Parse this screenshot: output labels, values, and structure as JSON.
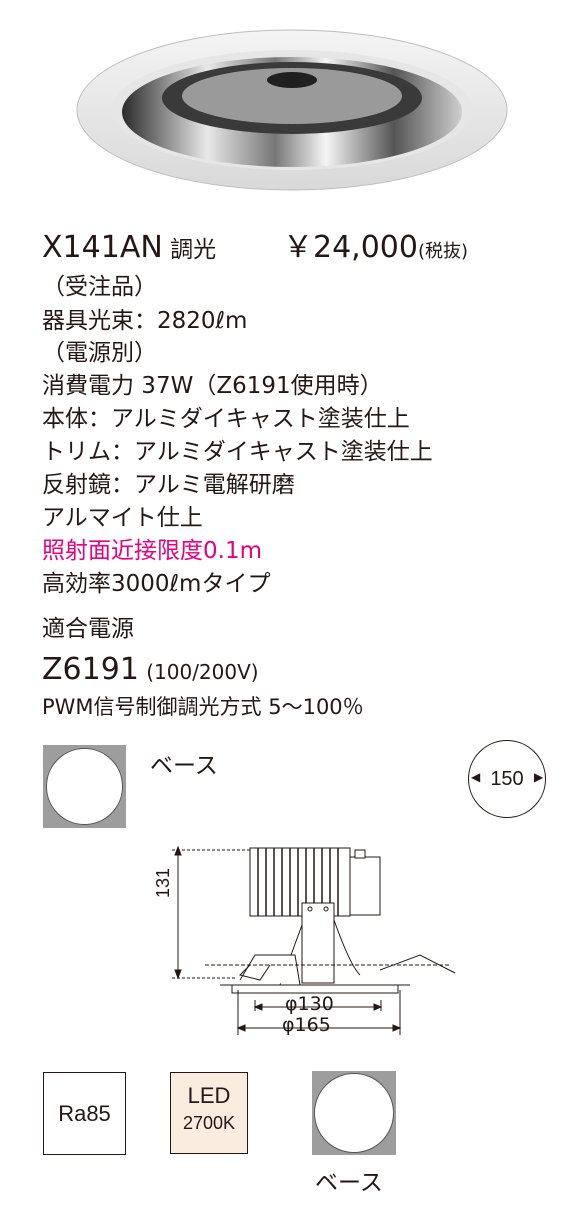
{
  "product": {
    "model": "X141AN",
    "dimming": "調光",
    "price": "￥24,000",
    "tax_note": "(税抜)",
    "order_note": "（受注品）",
    "lumen": "器具光束：2820ℓm",
    "power_note": "（電源別）",
    "consumption": "消費電力 37W（Z6191使用時）",
    "body_finish": "本体：アルミダイキャスト塗装仕上",
    "trim_finish": "トリム：アルミダイキャスト塗装仕上",
    "reflector_line1": "反射鏡：アルミ電解研磨",
    "reflector_line2": "アルマイト仕上",
    "beam_limit": "照射面近接限度0.1m",
    "efficiency": "高効率3000ℓmタイプ",
    "power_supply_heading": "適合電源",
    "power_supply_model": "Z6191",
    "power_supply_voltage": "(100/200V)",
    "dimming_method": "PWM信号制御調光方式 5〜100％"
  },
  "icons": {
    "base_label_top": "ベース",
    "cutout_size": "150",
    "base_label_bottom": "ベース"
  },
  "drawing": {
    "height": "131",
    "phi_inner": "φ130",
    "phi_outer": "φ165"
  },
  "badges": {
    "ra": "Ra85",
    "led_top": "LED",
    "led_bottom": "2700K"
  },
  "colors": {
    "text": "#231815",
    "accent_pink": "#e4007f",
    "base_gray": "#9d9d9d",
    "led_badge_bg": "#fbece0"
  }
}
